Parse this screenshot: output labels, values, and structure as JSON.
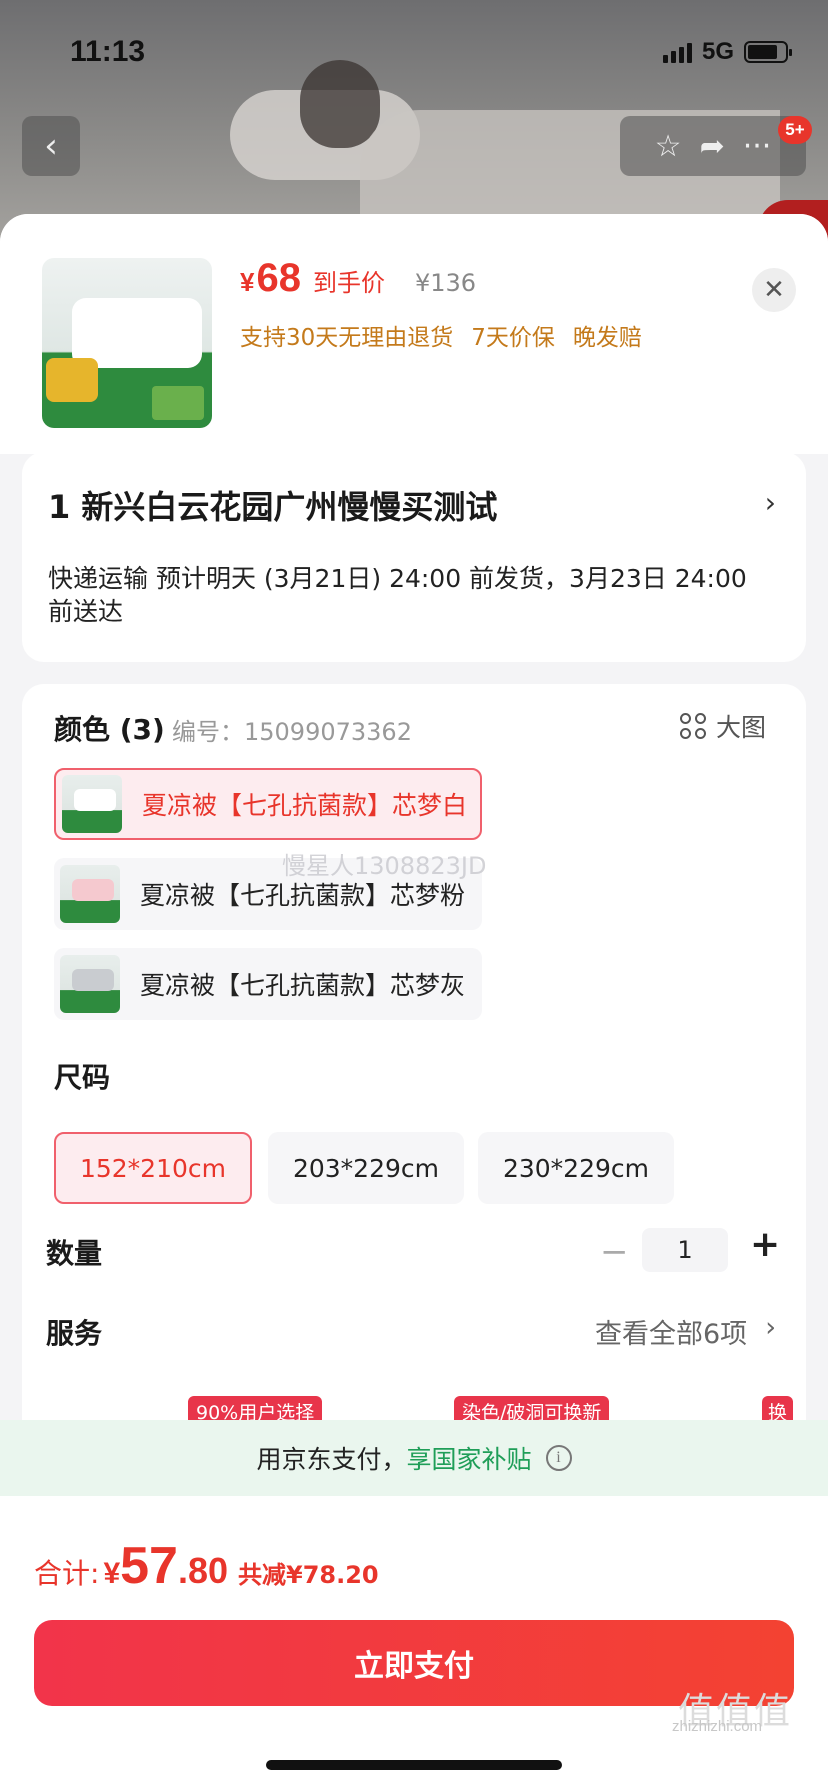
{
  "status_bar": {
    "time": "11:13",
    "network": "5G"
  },
  "nav": {
    "back": "‹",
    "badge": "5+"
  },
  "header": {
    "price_symbol": "¥",
    "price": "68",
    "price_tag": "到手价",
    "original_price": "¥136",
    "guarantees": [
      "支持30天无理由退货",
      "7天价保",
      "晚发赔"
    ]
  },
  "address": {
    "title": "1 新兴白云花园广州慢慢买测试",
    "shipping": "快递运输 预计明天 (3月21日) 24:00 前发货，3月23日 24:00 前送达"
  },
  "color": {
    "label": "颜色 (3)",
    "sku": "编号：15099073362",
    "big_pic": "大图",
    "options": [
      "夏凉被【七孔抗菌款】芯梦白",
      "夏凉被【七孔抗菌款】芯梦粉",
      "夏凉被【七孔抗菌款】芯梦灰"
    ],
    "watermark": "慢星人1308823JD"
  },
  "size": {
    "label": "尺码",
    "options": [
      "152*210cm",
      "203*229cm",
      "230*229cm"
    ]
  },
  "quantity": {
    "label": "数量",
    "minus": "−",
    "value": "1",
    "plus": "+"
  },
  "service": {
    "label": "服务",
    "more": "查看全部6项",
    "tags": [
      "90%用户选择",
      "染色/破洞可换新",
      "换"
    ]
  },
  "subsidy": {
    "text": "用京东支付，",
    "highlight": "享国家补贴",
    "icon": "i"
  },
  "footer": {
    "total_label": "合计:",
    "total_symbol": "¥",
    "total_int": "57",
    "total_dec": ".80",
    "save": "共减¥78.20",
    "pay_button": "立即支付"
  },
  "site": {
    "logo": "值值值",
    "url": "zhizhizhi.com"
  },
  "colors": {
    "accent": "#e8352b",
    "green": "#1f9e58",
    "guarantee": "#c47a1b"
  }
}
